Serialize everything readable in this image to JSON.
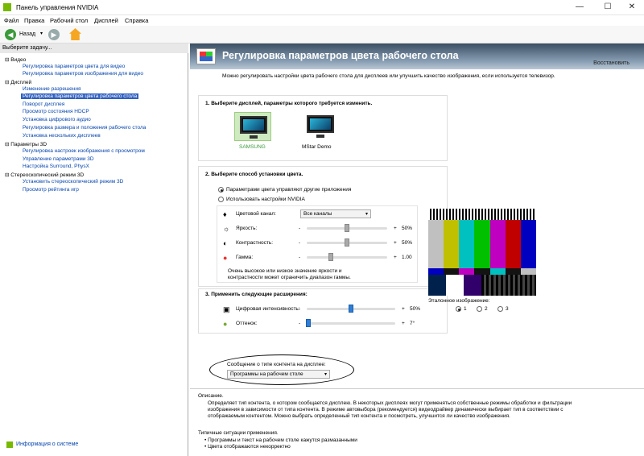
{
  "window": {
    "title": "Панель управления NVIDIA",
    "min": "—",
    "max": "☐",
    "close": "✕"
  },
  "menu": [
    "Файл",
    "Правка",
    "Рабочий стол",
    "Дисплей",
    "Справка"
  ],
  "toolbar": {
    "back_label": "Назад"
  },
  "sidebar": {
    "header": "Выберите задачу...",
    "categories": [
      {
        "label": "Видео",
        "items": [
          "Регулировка параметров цвета для видео",
          "Регулировка параметров изображения для видео"
        ]
      },
      {
        "label": "Дисплей",
        "items": [
          "Изменение разрешения",
          "Регулировка параметров цвета рабочего стола",
          "Поворот дисплея",
          "Просмотр состояния HDCP",
          "Установка цифрового аудио",
          "Регулировка размера и положения рабочего стола",
          "Установка нескольких дисплеев"
        ]
      },
      {
        "label": "Параметры 3D",
        "items": [
          "Регулировка настроек изображения с просмотром",
          "Управление параметрами 3D",
          "Настройка Surround, PhysX"
        ]
      },
      {
        "label": "Стереоскопический режим 3D",
        "items": [
          "Установить стереоскопический режим 3D",
          "Просмотр рейтинга игр"
        ]
      }
    ],
    "selected": "Регулировка параметров цвета рабочего стола",
    "system_info": "Информация о системе"
  },
  "page": {
    "title": "Регулировка параметров цвета рабочего стола",
    "restore_defaults": "Восстановить",
    "intro": "Можно регулировать настройки цвета рабочего стола для дисплеев или улучшить качество изображения, если используется телевизор.",
    "step1": "1. Выберите дисплей, параметры которого требуется изменить.",
    "displays": [
      {
        "name": "SAMSUNG",
        "selected": true
      },
      {
        "name": "MStar Demo",
        "selected": false
      }
    ],
    "step2": "2. Выберите способ установки цвета.",
    "color_mode_options": [
      "Параметрами цвета управляют другие приложения",
      "Использовать настройки NVIDIA"
    ],
    "color_mode_selected": 0,
    "channel_label": "Цветовой канал:",
    "channel_value": "Все каналы",
    "brightness": {
      "label": "Яркость:",
      "value": "50%",
      "level": 0.5
    },
    "contrast": {
      "label": "Контрастность:",
      "value": "50%",
      "level": 0.5
    },
    "gamma": {
      "label": "Гамма:",
      "value": "1.00",
      "level": 0.3
    },
    "warning": "Очень высокое или низкое значение яркости и контрастности может ограничить диапазон гаммы.",
    "step3": "3. Применить следующие расширения:",
    "digital_vibrance": {
      "label": "Цифровая интенсивность:",
      "value": "50%",
      "level": 0.5
    },
    "hue": {
      "label": "Оттенок:",
      "value": "7°",
      "level": 0.02
    },
    "minus": "-",
    "plus": "+",
    "reference_label": "Эталонное изображение:",
    "reference_options": [
      "1",
      "2",
      "3"
    ],
    "reference_selected": "1",
    "content_type_label": "Сообщение о типе контента на дисплее:",
    "content_type_value": "Программы на рабочем столе",
    "description_title": "Описание.",
    "description": "Определяет тип контента, о котором сообщается дисплею. В некоторых дисплеях могут применяться собственные режимы обработки и фильтрации изображения в зависимости от типа контента. В режиме автовыбора (рекомендуется) видеодрайвер динамически выбирает тип в соответствии с отображаемым контентом. Можно выбрать определенный тип контента и посмотреть, улучшится ли качество изображения.",
    "typical_title": "Типичные ситуации применения.",
    "typical": [
      "• Программы и текст на рабочем столе кажутся размазанными",
      "• Цвета отображаются некорректно"
    ]
  },
  "colors": {
    "nvidia_green": "#76b900",
    "selection_blue": "#3060c0",
    "banner": "#3b4e63"
  }
}
